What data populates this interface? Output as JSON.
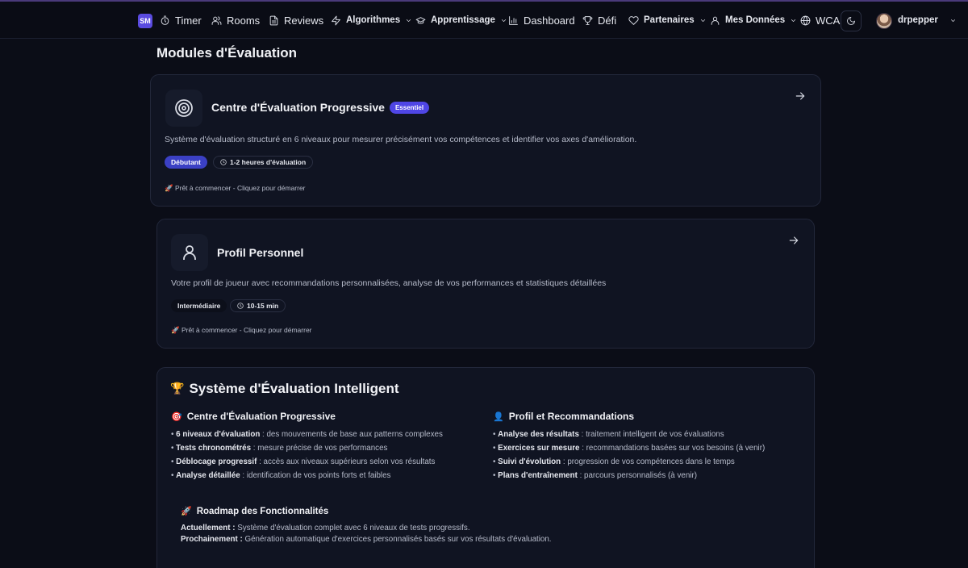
{
  "navbar": {
    "logo": "SM",
    "items": [
      {
        "label": "Timer",
        "icon": "timer-icon"
      },
      {
        "label": "Rooms",
        "icon": "users-icon"
      },
      {
        "label": "Reviews",
        "icon": "file-icon"
      },
      {
        "label": "Algorithmes",
        "icon": "zap-icon",
        "dropdown": true
      },
      {
        "label": "Apprentissage",
        "icon": "graduation-cap-icon",
        "dropdown": true
      },
      {
        "label": "Dashboard",
        "icon": "bar-chart-icon"
      },
      {
        "label": "Défi",
        "icon": "trophy-icon"
      },
      {
        "label": "Partenaires",
        "icon": "heart-icon",
        "dropdown": true
      },
      {
        "label": "Mes Données",
        "icon": "user-icon",
        "dropdown": true
      },
      {
        "label": "WCA",
        "icon": "globe-icon"
      }
    ],
    "theme_toggle_icon": "moon-icon",
    "username": "drpepper"
  },
  "main": {
    "section_title": "Modules d'Évaluation",
    "cards": [
      {
        "title": "Centre d'Évaluation Progressive",
        "badge": "Essentiel",
        "description": "Système d'évaluation structuré en 6 niveaux pour mesurer précisément vos compétences et identifier vos axes d'amélioration.",
        "level": "Débutant",
        "duration": "1-2 heures d'évaluation",
        "status": "🚀 Prêt à commencer - Cliquez pour démarrer",
        "icon": "target-icon"
      },
      {
        "title": "Profil Personnel",
        "description": "Votre profil de joueur avec recommandations personnalisées, analyse de vos performances et statistiques détaillées",
        "level": "Intermédiaire",
        "duration": "10-15 min",
        "status": "🚀 Prêt à commencer - Cliquez pour démarrer",
        "icon": "user-icon"
      }
    ]
  },
  "info": {
    "title": "Système d'Évaluation Intelligent",
    "title_emoji": "🏆",
    "left": {
      "emoji": "🎯",
      "title": "Centre d'Évaluation Progressive",
      "items": [
        {
          "bold": "6 niveaux d'évaluation",
          "text": " : des mouvements de base aux patterns complexes"
        },
        {
          "bold": "Tests chronométrés",
          "text": " : mesure précise de vos performances"
        },
        {
          "bold": "Déblocage progressif",
          "text": " : accès aux niveaux supérieurs selon vos résultats"
        },
        {
          "bold": "Analyse détaillée",
          "text": " : identification de vos points forts et faibles"
        }
      ]
    },
    "right": {
      "emoji": "👤",
      "title": "Profil et Recommandations",
      "items": [
        {
          "bold": "Analyse des résultats",
          "text": " : traitement intelligent de vos évaluations"
        },
        {
          "bold": "Exercices sur mesure",
          "text": " : recommandations basées sur vos besoins (à venir)"
        },
        {
          "bold": "Suivi d'évolution",
          "text": " : progression de vos compétences dans le temps"
        },
        {
          "bold": "Plans d'entraînement",
          "text": " : parcours personnalisés (à venir)"
        }
      ]
    },
    "roadmap": {
      "emoji": "🚀",
      "title": "Roadmap des Fonctionnalités",
      "current_label": "Actuellement :",
      "current_text": " Système d'évaluation complet avec 6 niveaux de tests progressifs.",
      "next_label": "Prochainement :",
      "next_text": " Génération automatique d'exercices personnalisés basés sur vos résultats d'évaluation."
    }
  },
  "colors": {
    "background": "#0b0d17",
    "card": "#101422",
    "accent": "#4f46e5"
  }
}
